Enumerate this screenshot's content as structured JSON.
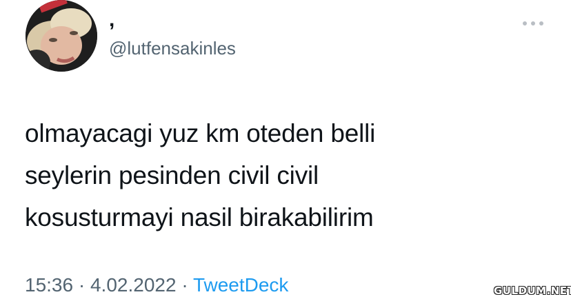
{
  "tweet": {
    "author": {
      "display_name": ",",
      "handle": "@lutfensakinles",
      "avatar": "profile-photo"
    },
    "more_icon": "more-dots-icon",
    "text_lines": [
      "olmayacagi yuz km oteden belli",
      "seylerin pesinden civil civil",
      "kosusturmayi nasil birakabilirim"
    ],
    "time": "15:36",
    "separator": "·",
    "date": "4.02.2022",
    "source": "TweetDeck"
  },
  "watermark": "GULDUM.NET",
  "colors": {
    "text": "#0f1419",
    "muted": "#536471",
    "link": "#1d9bf0",
    "background": "#ffffff"
  }
}
